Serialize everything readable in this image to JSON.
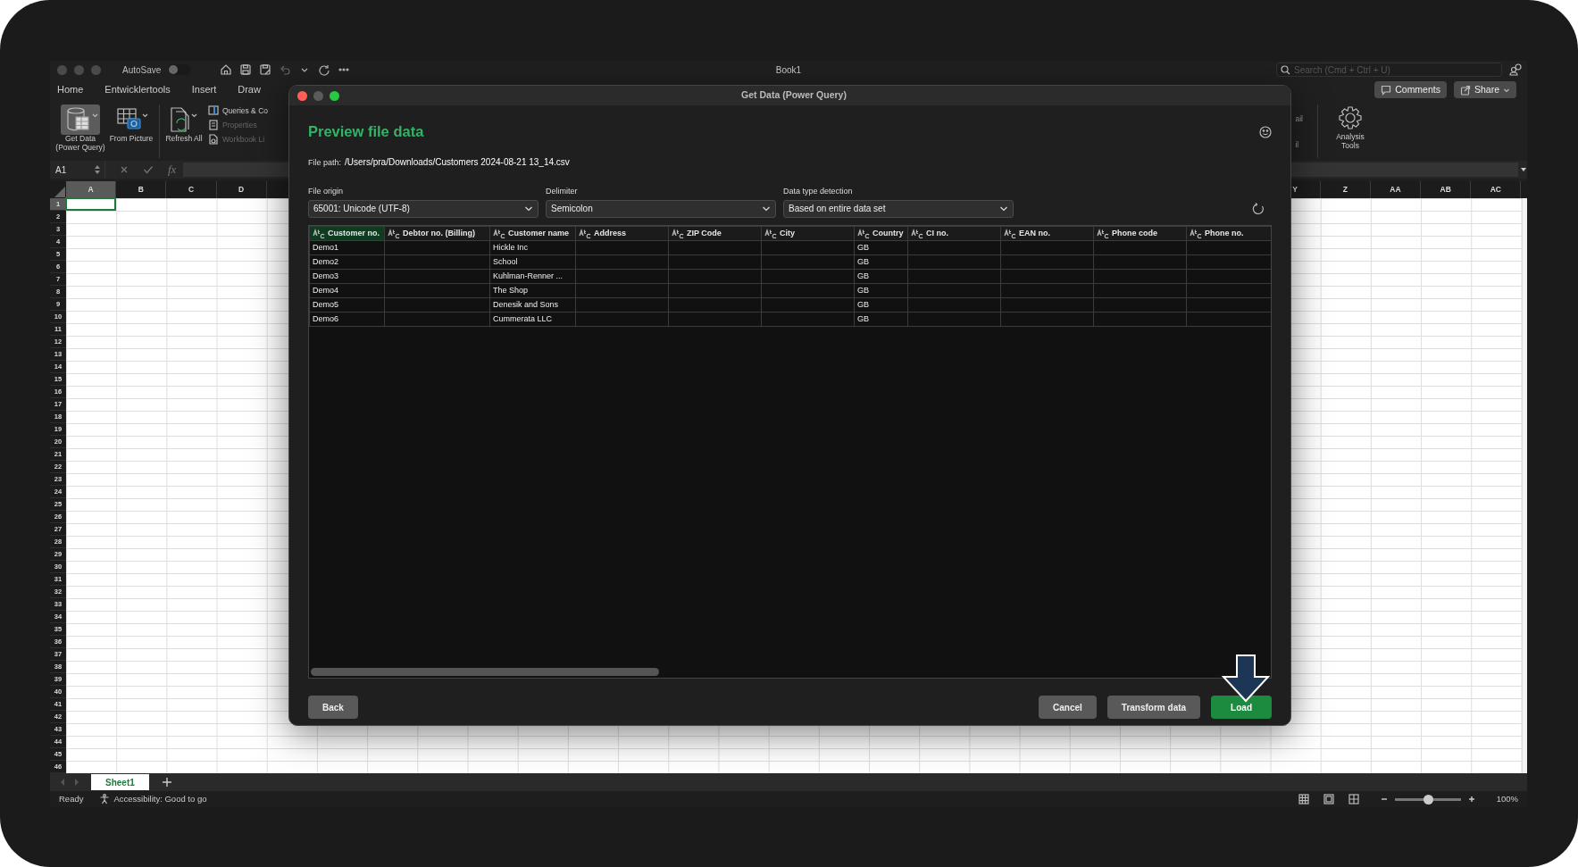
{
  "excel": {
    "window_title": "Book1",
    "autosave": {
      "label": "AutoSave",
      "on": false
    },
    "search": {
      "placeholder": "Search (Cmd + Ctrl + U)"
    },
    "ribbon_tabs": [
      "Home",
      "Entwicklertools",
      "Insert",
      "Draw"
    ],
    "comments_button": "Comments",
    "share_button": "Share",
    "ribbon_buttons": [
      {
        "label": "Get Data (Power Query)",
        "selected": true
      },
      {
        "label": "From Picture",
        "selected": false
      },
      {
        "label": "Refresh All",
        "selected": false
      }
    ],
    "ribbon_small": [
      {
        "label": "Queries & Co",
        "disabled": false
      },
      {
        "label": "Properties",
        "disabled": true
      },
      {
        "label": "Workbook Li",
        "disabled": true
      }
    ],
    "ribbon_fragments": [
      "ail",
      "il"
    ],
    "analysis_tools": "Analysis Tools",
    "name_box": "A1",
    "formula_label": "fx",
    "columns_left": [
      {
        "label": "A",
        "selected": true
      },
      {
        "label": "B",
        "selected": false
      },
      {
        "label": "C",
        "selected": false
      },
      {
        "label": "D",
        "selected": false
      }
    ],
    "columns_right": [
      {
        "label": "Y",
        "selected": false
      },
      {
        "label": "Z",
        "selected": false
      },
      {
        "label": "AA",
        "selected": false
      },
      {
        "label": "AB",
        "selected": false
      },
      {
        "label": "AC",
        "selected": false
      }
    ],
    "rows": [
      {
        "label": "1",
        "selected": true
      },
      {
        "label": "2",
        "selected": false
      },
      {
        "label": "3",
        "selected": false
      },
      {
        "label": "4",
        "selected": false
      },
      {
        "label": "5",
        "selected": false
      },
      {
        "label": "6",
        "selected": false
      },
      {
        "label": "7",
        "selected": false
      },
      {
        "label": "8",
        "selected": false
      },
      {
        "label": "9",
        "selected": false
      },
      {
        "label": "10",
        "selected": false
      },
      {
        "label": "11",
        "selected": false
      },
      {
        "label": "12",
        "selected": false
      },
      {
        "label": "13",
        "selected": false
      },
      {
        "label": "14",
        "selected": false
      },
      {
        "label": "15",
        "selected": false
      },
      {
        "label": "16",
        "selected": false
      },
      {
        "label": "17",
        "selected": false
      },
      {
        "label": "18",
        "selected": false
      },
      {
        "label": "19",
        "selected": false
      },
      {
        "label": "20",
        "selected": false
      },
      {
        "label": "21",
        "selected": false
      },
      {
        "label": "22",
        "selected": false
      },
      {
        "label": "23",
        "selected": false
      },
      {
        "label": "24",
        "selected": false
      },
      {
        "label": "25",
        "selected": false
      },
      {
        "label": "26",
        "selected": false
      },
      {
        "label": "27",
        "selected": false
      },
      {
        "label": "28",
        "selected": false
      },
      {
        "label": "29",
        "selected": false
      },
      {
        "label": "30",
        "selected": false
      },
      {
        "label": "31",
        "selected": false
      },
      {
        "label": "32",
        "selected": false
      },
      {
        "label": "33",
        "selected": false
      },
      {
        "label": "34",
        "selected": false
      },
      {
        "label": "35",
        "selected": false
      },
      {
        "label": "36",
        "selected": false
      },
      {
        "label": "37",
        "selected": false
      },
      {
        "label": "38",
        "selected": false
      },
      {
        "label": "39",
        "selected": false
      },
      {
        "label": "40",
        "selected": false
      },
      {
        "label": "41",
        "selected": false
      },
      {
        "label": "42",
        "selected": false
      },
      {
        "label": "43",
        "selected": false
      },
      {
        "label": "44",
        "selected": false
      },
      {
        "label": "45",
        "selected": false
      },
      {
        "label": "46",
        "selected": false
      }
    ],
    "sheet_tabs": [
      {
        "label": "Sheet1",
        "selected": true
      }
    ],
    "status": "Ready",
    "accessibility": "Accessibility: Good to go",
    "zoom": {
      "level": 0.5,
      "reading": "100%"
    }
  },
  "dialog": {
    "title": "Get Data (Power Query)",
    "heading": "Preview file data",
    "file_path_label": "File path:",
    "file_path": "/Users/pra/Downloads/Customers 2024-08-21 13_14.csv",
    "fields": [
      {
        "label": "File origin",
        "value": "65001: Unicode (UTF-8)"
      },
      {
        "label": "Delimiter",
        "value": "Semicolon"
      },
      {
        "label": "Data type detection",
        "value": "Based on entire data set"
      }
    ],
    "table": {
      "columns": [
        {
          "label": "Customer no.",
          "selected": true
        },
        {
          "label": "Debtor no. (Billing)",
          "selected": false
        },
        {
          "label": "Customer name",
          "selected": false
        },
        {
          "label": "Address",
          "selected": false
        },
        {
          "label": "ZIP Code",
          "selected": false
        },
        {
          "label": "City",
          "selected": false
        },
        {
          "label": "Country",
          "selected": false
        },
        {
          "label": "CI no.",
          "selected": false
        },
        {
          "label": "EAN no.",
          "selected": false
        },
        {
          "label": "Phone code",
          "selected": false
        },
        {
          "label": "Phone no.",
          "selected": false
        }
      ],
      "rows": [
        [
          "Demo1",
          null,
          "Hickle Inc",
          null,
          null,
          null,
          "GB",
          null,
          null,
          null,
          null
        ],
        [
          "Demo2",
          null,
          "School",
          null,
          null,
          null,
          "GB",
          null,
          null,
          null,
          null
        ],
        [
          "Demo3",
          null,
          "Kuhlman-Renner ...",
          null,
          null,
          null,
          "GB",
          null,
          null,
          null,
          null
        ],
        [
          "Demo4",
          null,
          "The Shop",
          null,
          null,
          null,
          "GB",
          null,
          null,
          null,
          null
        ],
        [
          "Demo5",
          null,
          "Denesik and Sons",
          null,
          null,
          null,
          "GB",
          null,
          null,
          null,
          null
        ],
        [
          "Demo6",
          null,
          "Cummerata LLC",
          null,
          null,
          null,
          "GB",
          null,
          null,
          null,
          null
        ]
      ]
    },
    "back_button": "Back",
    "buttons": [
      {
        "label": "Cancel",
        "kind": "secondary"
      },
      {
        "label": "Transform data",
        "kind": "secondary"
      },
      {
        "label": "Load",
        "kind": "primary"
      }
    ]
  }
}
